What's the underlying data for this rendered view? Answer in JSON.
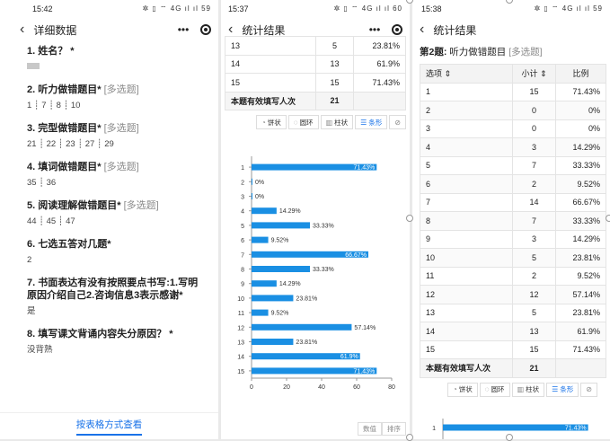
{
  "panel1": {
    "time": "15:42",
    "status_icons": "✲ ▯ ⌔ 4G ıl ıl 59",
    "title": "详细数据",
    "questions": [
      {
        "title": "1. 姓名？ *",
        "tag": "",
        "answer": ""
      },
      {
        "title": "2. 听力做错题目* ",
        "tag": "[多选题]",
        "answer": "1 ┊ 7 ┊ 8 ┊ 10"
      },
      {
        "title": "3. 完型做错题目* ",
        "tag": "[多选题]",
        "answer": "21 ┊ 22 ┊ 23 ┊ 27 ┊ 29"
      },
      {
        "title": "4. 填词做错题目* ",
        "tag": "[多选题]",
        "answer": "35 ┊ 36"
      },
      {
        "title": "5. 阅读理解做错题目* ",
        "tag": "[多选题]",
        "answer": "44 ┊ 45 ┊ 47"
      },
      {
        "title": "6. 七选五答对几题*",
        "tag": "",
        "answer": "2"
      },
      {
        "title": "7. 书面表达有没有按照要点书写:1.写明原因介绍自己2.咨询信息3表示感谢*",
        "tag": "",
        "answer": "是"
      },
      {
        "title": "8. 填写课文背诵内容失分原因？ *",
        "tag": "",
        "answer": "没背熟"
      }
    ],
    "footer_link": "按表格方式查看"
  },
  "panel2": {
    "time": "15:37",
    "status_icons": "✲ ▯ ⌔ 4G ıl ıl 60",
    "title": "统计结果",
    "rows": [
      {
        "option": "13",
        "count": "5",
        "pct": "23.81%"
      },
      {
        "option": "14",
        "count": "13",
        "pct": "61.9%"
      },
      {
        "option": "15",
        "count": "15",
        "pct": "71.43%"
      }
    ],
    "summary_label": "本题有效填写人次",
    "summary_value": "21",
    "chart_tabs": [
      "饼状",
      "圆环",
      "柱状",
      "条形"
    ],
    "sort_buttons": [
      "数值",
      "排序"
    ]
  },
  "panel3": {
    "time": "15:38",
    "status_icons": "✲ ▯ ⌔ 4G ıl ıl 59",
    "title": "统计结果",
    "question_no": "第2题:",
    "question_text": " 听力做错题目 ",
    "question_tag": "[多选题]",
    "headers": [
      "选项 ⇕",
      "小计 ⇕",
      "比例"
    ],
    "rows": [
      {
        "option": "1",
        "count": "15",
        "pct": "71.43%"
      },
      {
        "option": "2",
        "count": "0",
        "pct": "0%"
      },
      {
        "option": "3",
        "count": "0",
        "pct": "0%"
      },
      {
        "option": "4",
        "count": "3",
        "pct": "14.29%"
      },
      {
        "option": "5",
        "count": "7",
        "pct": "33.33%"
      },
      {
        "option": "6",
        "count": "2",
        "pct": "9.52%"
      },
      {
        "option": "7",
        "count": "14",
        "pct": "66.67%"
      },
      {
        "option": "8",
        "count": "7",
        "pct": "33.33%"
      },
      {
        "option": "9",
        "count": "3",
        "pct": "14.29%"
      },
      {
        "option": "10",
        "count": "5",
        "pct": "23.81%"
      },
      {
        "option": "11",
        "count": "2",
        "pct": "9.52%"
      },
      {
        "option": "12",
        "count": "12",
        "pct": "57.14%"
      },
      {
        "option": "13",
        "count": "5",
        "pct": "23.81%"
      },
      {
        "option": "14",
        "count": "13",
        "pct": "61.9%"
      },
      {
        "option": "15",
        "count": "15",
        "pct": "71.43%"
      }
    ],
    "summary_label": "本题有效填写人次",
    "summary_value": "21",
    "chart_tabs": [
      "饼状",
      "圆环",
      "柱状",
      "条形"
    ],
    "partial_bar": {
      "label": "1",
      "value": 71.43,
      "text": "71.43%"
    }
  },
  "colors": {
    "bar": "#1a8fe3",
    "link": "#1a73e8"
  },
  "chart_data": {
    "type": "bar",
    "orientation": "horizontal",
    "categories": [
      "1",
      "2",
      "3",
      "4",
      "5",
      "6",
      "7",
      "8",
      "9",
      "10",
      "11",
      "12",
      "13",
      "14",
      "15"
    ],
    "values": [
      71.43,
      0,
      0,
      14.29,
      33.33,
      9.52,
      66.67,
      33.33,
      14.29,
      23.81,
      9.52,
      57.14,
      23.81,
      61.9,
      71.43
    ],
    "labels": [
      "71.43%",
      "0%",
      "0%",
      "14.29%",
      "33.33%",
      "9.52%",
      "66.67%",
      "33.33%",
      "14.29%",
      "23.81%",
      "9.52%",
      "57.14%",
      "23.81%",
      "61.9%",
      "71.43%"
    ],
    "xticks": [
      "0",
      "20",
      "40",
      "60",
      "80"
    ],
    "xlim": [
      0,
      80
    ]
  }
}
